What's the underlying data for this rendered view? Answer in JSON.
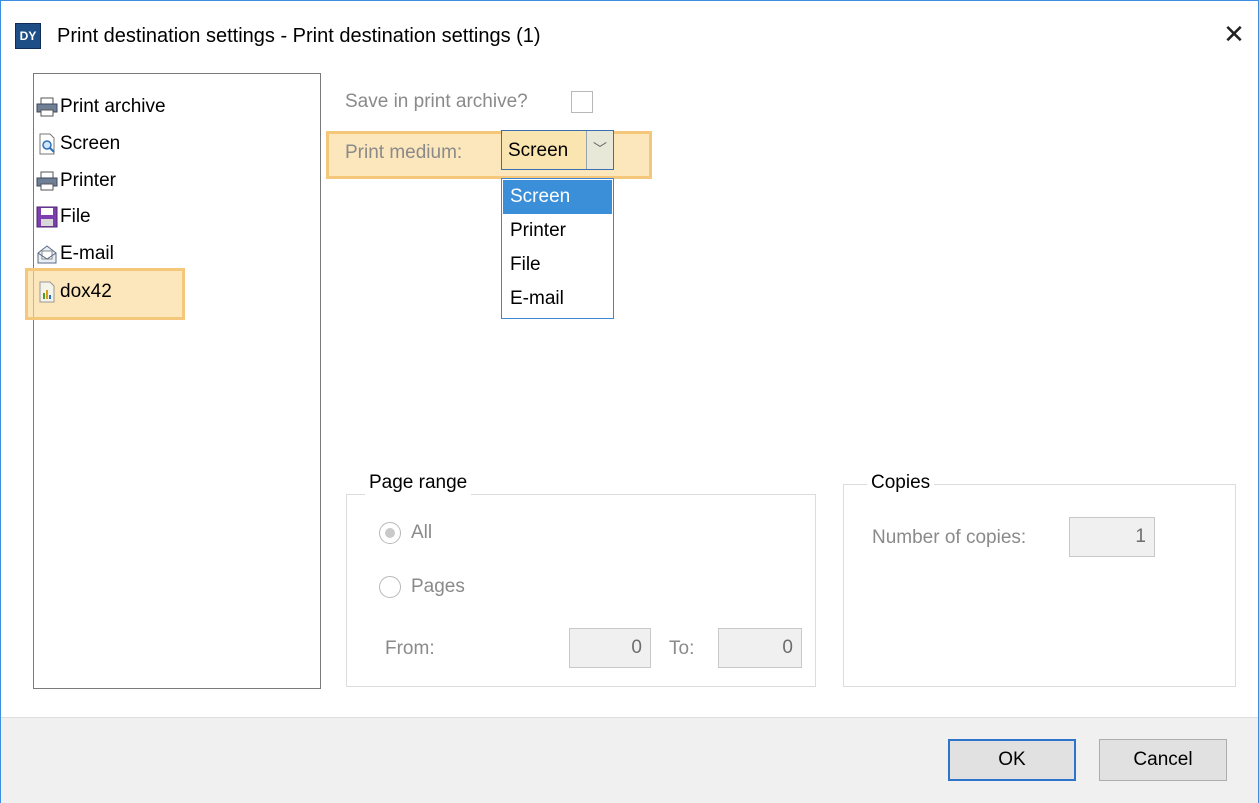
{
  "window": {
    "title": "Print destination settings - Print destination settings (1)",
    "close_glyph": "✕",
    "app_icon_text": "DY"
  },
  "tree": {
    "items": [
      {
        "label": "Print archive",
        "icon": "printer-icon"
      },
      {
        "label": "Screen",
        "icon": "screen-preview-icon"
      },
      {
        "label": "Printer",
        "icon": "printer-icon"
      },
      {
        "label": "File",
        "icon": "floppy-disk-icon"
      },
      {
        "label": "E-mail",
        "icon": "email-icon"
      },
      {
        "label": "dox42",
        "icon": "dox42-document-icon",
        "highlighted": true
      }
    ]
  },
  "settings": {
    "save_archive_label": "Save in print archive?",
    "save_archive_checked": false,
    "print_medium_label": "Print medium:",
    "print_medium_value": "Screen",
    "dropdown_arrow": "﹀",
    "print_medium_options": [
      "Screen",
      "Printer",
      "File",
      "E-mail"
    ],
    "print_medium_selected": "Screen"
  },
  "page_range": {
    "title": "Page range",
    "all_label": "All",
    "pages_label": "Pages",
    "selected": "All",
    "from_label": "From:",
    "from_value": "0",
    "to_label": "To:",
    "to_value": "0"
  },
  "copies": {
    "title": "Copies",
    "number_label": "Number of copies:",
    "number_value": "1"
  },
  "buttons": {
    "ok": "OK",
    "cancel": "Cancel"
  },
  "colors": {
    "highlight": "#fad896",
    "accent": "#3b8fd9",
    "window_border": "#3d8ee0"
  }
}
